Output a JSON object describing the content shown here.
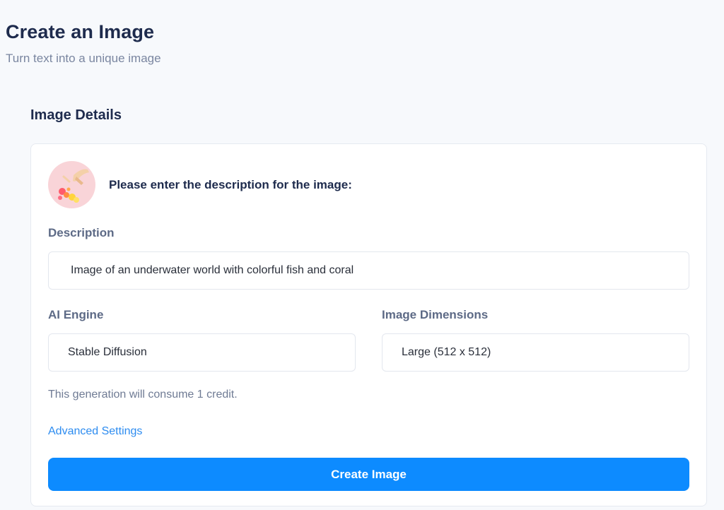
{
  "header": {
    "title": "Create an Image",
    "subtitle": "Turn text into a unique image"
  },
  "section": {
    "title": "Image Details"
  },
  "card": {
    "intro_text": "Please enter the description for the image:",
    "description": {
      "label": "Description",
      "value": "Image of an underwater world with colorful fish and coral"
    },
    "engine": {
      "label": "AI Engine",
      "value": "Stable Diffusion"
    },
    "dimensions": {
      "label": "Image Dimensions",
      "value": "Large (512 x 512)"
    },
    "credit_note": "This generation will consume 1 credit.",
    "advanced_link": "Advanced Settings",
    "create_button": "Create Image"
  },
  "colors": {
    "accent": "#0d8bff",
    "link": "#2d8cf0",
    "heading": "#1e2b4d",
    "muted": "#6f7b94",
    "avatar_bg": "#f9d4d8"
  }
}
